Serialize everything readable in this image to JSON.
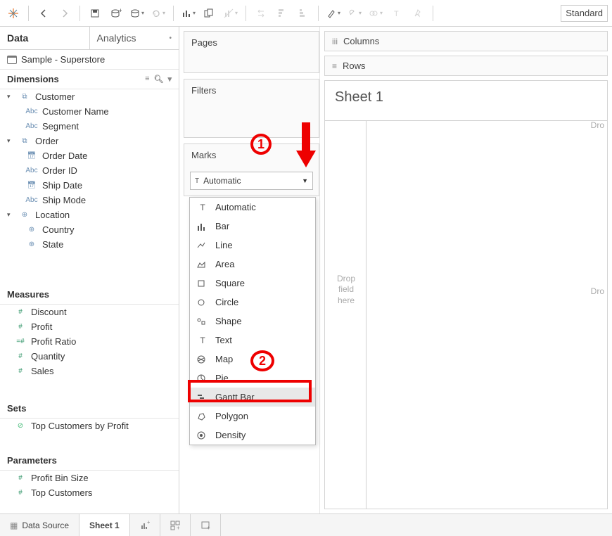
{
  "toolbar": {
    "zoom_label": "Standard"
  },
  "tabs": {
    "data": "Data",
    "analytics": "Analytics"
  },
  "datasource": "Sample - Superstore",
  "sections": {
    "dimensions": "Dimensions",
    "measures": "Measures",
    "sets": "Sets",
    "parameters": "Parameters"
  },
  "dim_groups": [
    {
      "name": "Customer",
      "fields": [
        {
          "label": "Customer Name",
          "type": "str"
        },
        {
          "label": "Segment",
          "type": "str"
        }
      ]
    },
    {
      "name": "Order",
      "fields": [
        {
          "label": "Order Date",
          "type": "date"
        },
        {
          "label": "Order ID",
          "type": "str"
        },
        {
          "label": "Ship Date",
          "type": "date"
        },
        {
          "label": "Ship Mode",
          "type": "str"
        }
      ]
    },
    {
      "name": "Location",
      "fields": [
        {
          "label": "Country",
          "type": "geo"
        },
        {
          "label": "State",
          "type": "geo"
        }
      ]
    }
  ],
  "measures": [
    "Discount",
    "Profit",
    "Profit Ratio",
    "Quantity",
    "Sales"
  ],
  "sets": [
    "Top Customers by Profit"
  ],
  "parameters": [
    "Profit Bin Size",
    "Top Customers"
  ],
  "cards": {
    "pages": "Pages",
    "filters": "Filters",
    "marks": "Marks",
    "marks_selected": "Automatic"
  },
  "mark_types": [
    {
      "label": "Automatic",
      "icon": "T"
    },
    {
      "label": "Bar",
      "icon": "bar"
    },
    {
      "label": "Line",
      "icon": "line"
    },
    {
      "label": "Area",
      "icon": "area"
    },
    {
      "label": "Square",
      "icon": "sq"
    },
    {
      "label": "Circle",
      "icon": "circ"
    },
    {
      "label": "Shape",
      "icon": "shape"
    },
    {
      "label": "Text",
      "icon": "T"
    },
    {
      "label": "Map",
      "icon": "map"
    },
    {
      "label": "Pie",
      "icon": "pie"
    },
    {
      "label": "Gantt Bar",
      "icon": "gantt"
    },
    {
      "label": "Polygon",
      "icon": "poly"
    },
    {
      "label": "Density",
      "icon": "dens"
    }
  ],
  "shelves": {
    "columns": "Columns",
    "rows": "Rows"
  },
  "sheet": {
    "title": "Sheet 1",
    "drop_right": "Dro",
    "drop_center": "Drop field here",
    "drop_right2": "Dro"
  },
  "bottom": {
    "data_source": "Data Source",
    "sheet1": "Sheet 1"
  },
  "annotations": {
    "step1": "1",
    "step2": "2"
  }
}
